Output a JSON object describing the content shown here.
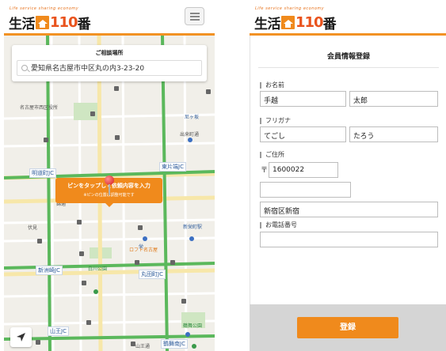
{
  "brand": {
    "tagline": "Life service sharing economy",
    "name_prefix": "生活",
    "name_number": "110",
    "name_suffix": "番"
  },
  "map_screen": {
    "search": {
      "title": "ご相談場所",
      "value": "愛知県名古屋市中区丸の内3-23-20"
    },
    "tooltip": {
      "main": "ピンをタップして依頼内容を入力",
      "sub": "※ピンの位置は調整可能です"
    },
    "labels": {
      "nishi_ward_office": "名古屋市西区役所",
      "akari": "尼ヶ坂",
      "deraimachi": "出来町通",
      "meieki_jc": "明道町JC",
      "kita_jc": "丸田町JC",
      "higashi_jc": "東片端JC",
      "shinsu_jc": "新洲崎JC",
      "marutamachi_jc": "丸田町JC",
      "yamaou_jc": "山王JC",
      "tsurumai_jc": "鶴舞南JC",
      "loft": "ロフト名古屋",
      "sakae": "栄",
      "shin_sakae": "新栄町駅",
      "hirokoji": "広小路",
      "kinshachi": "錦通",
      "fushimi": "伏見",
      "sanno": "山王通",
      "tsurumai_park": "鶴舞公園",
      "osu": "大須",
      "shirakawa": "白川公園",
      "sumiyoshi": "住吉",
      "tenma": "天馬"
    }
  },
  "form_screen": {
    "title": "会員情報登録",
    "name_label": "お名前",
    "last_name": "手越",
    "first_name": "太郎",
    "kana_label": "フリガナ",
    "last_kana": "てごし",
    "first_kana": "たろう",
    "address_label": "ご住所",
    "postal_mark": "〒",
    "postal_code": "1600022",
    "address_line1": "",
    "address_line2": "新宿区新宿",
    "phone_label": "お電話番号",
    "phone": "",
    "submit_label": "登録"
  },
  "colors": {
    "accent": "#f08a1c",
    "header_rule": "#f29224",
    "pin": "#d41a1a",
    "footer": "#d5d5d5"
  }
}
